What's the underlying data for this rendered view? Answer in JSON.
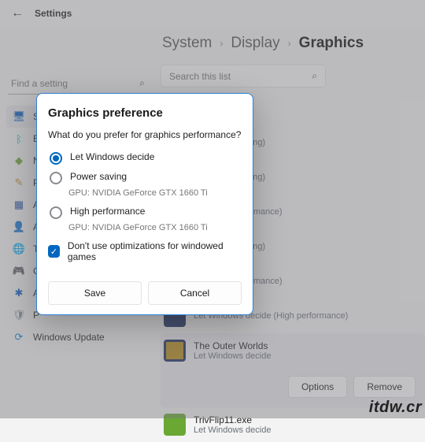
{
  "top": {
    "title": "Settings"
  },
  "search": {
    "placeholder": "Find a setting"
  },
  "nav": [
    {
      "label": "System",
      "cls": "c-blue",
      "glyph": "🖥"
    },
    {
      "label": "Bluetooth & devices",
      "cls": "c-teal",
      "glyph": "ᛒ"
    },
    {
      "label": "Network & internet",
      "cls": "c-green",
      "glyph": "◆"
    },
    {
      "label": "Personalization",
      "cls": "c-tan",
      "glyph": "✎"
    },
    {
      "label": "Apps",
      "cls": "c-darkblue",
      "glyph": "▦"
    },
    {
      "label": "Accounts",
      "cls": "c-person",
      "glyph": "👤"
    },
    {
      "label": "Time & language",
      "cls": "c-globe",
      "glyph": "🌐"
    },
    {
      "label": "Gaming",
      "cls": "c-game",
      "glyph": "🎮"
    },
    {
      "label": "Accessibility",
      "cls": "c-access",
      "glyph": "✱"
    },
    {
      "label": "Privacy & security",
      "cls": "c-shield",
      "glyph": "🛡"
    },
    {
      "label": "Windows Update",
      "cls": "c-upd",
      "glyph": "⟳"
    }
  ],
  "breadcrumb": {
    "a": "System",
    "b": "Display",
    "c": "Graphics"
  },
  "listSearch": {
    "placeholder": "Search this list"
  },
  "apps": [
    {
      "name": "",
      "sub": "ide (Power saving)"
    },
    {
      "name": "",
      "sub": "ide (Power saving)"
    },
    {
      "name": "",
      "sub": "ide (High performance)"
    },
    {
      "name": "",
      "sub": "ide (Power saving)"
    },
    {
      "name": "",
      "sub": "ide (High performance)"
    },
    {
      "name": "",
      "sub": "Let Windows decide (High performance)"
    },
    {
      "name": "The Outer Worlds",
      "sub": "Let Windows decide"
    },
    {
      "name": "TrivFlip11.exe",
      "sub": "Let Windows decide"
    }
  ],
  "rowButtons": {
    "options": "Options",
    "remove": "Remove"
  },
  "dialog": {
    "title": "Graphics preference",
    "question": "What do you prefer for graphics performance?",
    "opt1": "Let Windows decide",
    "opt2": "Power saving",
    "opt2sub": "GPU: NVIDIA GeForce GTX 1660 Ti",
    "opt3": "High performance",
    "opt3sub": "GPU: NVIDIA GeForce GTX 1660 Ti",
    "check": "Don't use optimizations for windowed games",
    "save": "Save",
    "cancel": "Cancel"
  },
  "watermark": "itdw.cr"
}
